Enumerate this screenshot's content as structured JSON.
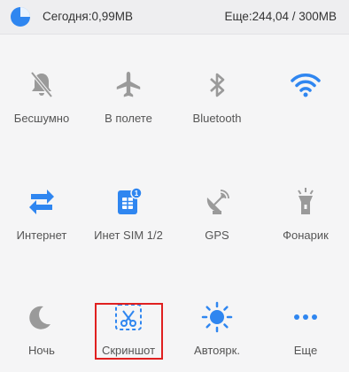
{
  "header": {
    "today_label": "Сегодня:0,99MB",
    "remaining_label": "Еще:244,04 / 300MB",
    "data_used_fraction": 0.33
  },
  "toggles": [
    {
      "label": "Бесшумно",
      "icon": "bell-off-icon",
      "active": false
    },
    {
      "label": "В полете",
      "icon": "airplane-icon",
      "active": false
    },
    {
      "label": "Bluetooth",
      "icon": "bluetooth-icon",
      "active": false
    },
    {
      "label": "",
      "icon": "wifi-icon",
      "active": true
    },
    {
      "label": "Интернет",
      "icon": "data-transfer-icon",
      "active": true
    },
    {
      "label": "Инет SIM 1/2",
      "icon": "sim-card-icon",
      "active": true
    },
    {
      "label": "GPS",
      "icon": "satellite-dish-icon",
      "active": false
    },
    {
      "label": "Фонарик",
      "icon": "flashlight-icon",
      "active": false
    },
    {
      "label": "Ночь",
      "icon": "moon-icon",
      "active": false
    },
    {
      "label": "Скриншот",
      "icon": "screenshot-scissors-icon",
      "active": true,
      "highlighted": true
    },
    {
      "label": "Автоярк.",
      "icon": "sun-icon",
      "active": true
    },
    {
      "label": "Еще",
      "icon": "more-dots-icon",
      "active": true
    }
  ],
  "colors": {
    "active": "#2f86f0",
    "inactive": "#9a9a9a",
    "highlight_border": "#e02020"
  }
}
